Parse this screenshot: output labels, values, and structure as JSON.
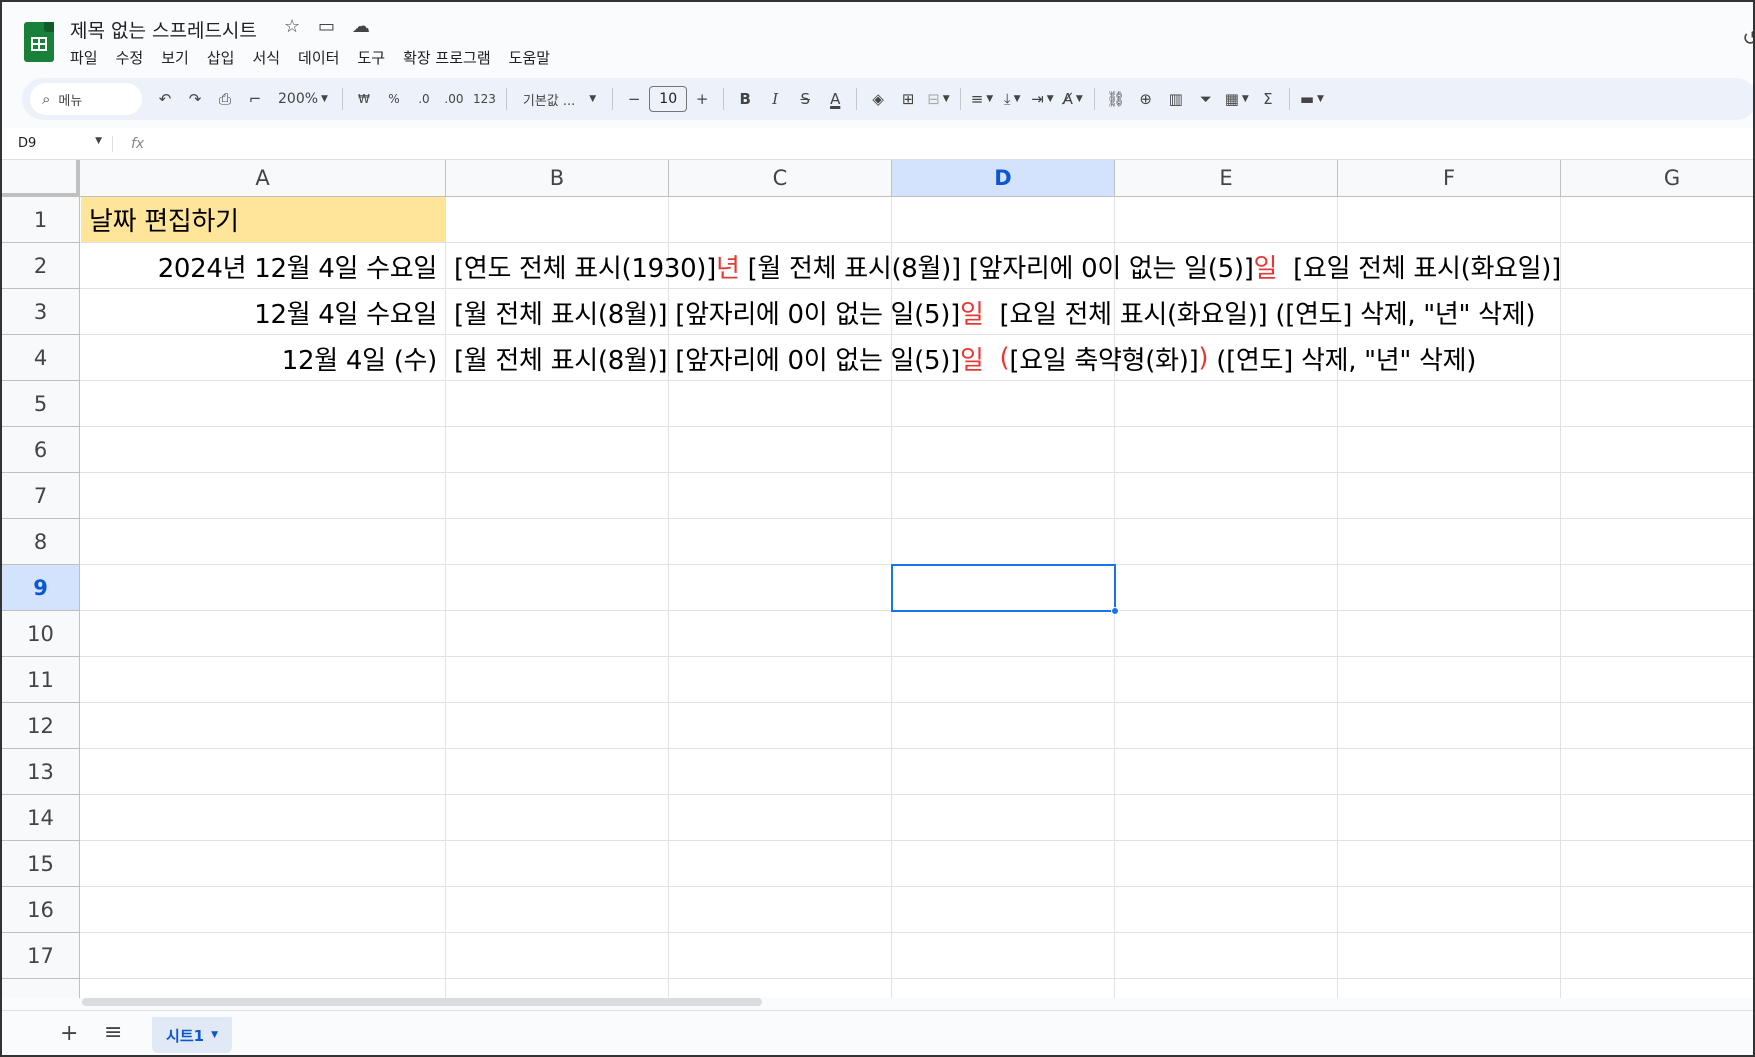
{
  "app": {
    "doc_title": "제목 없는 스프레드시트",
    "menus": [
      "파일",
      "수정",
      "보기",
      "삽입",
      "서식",
      "데이터",
      "도구",
      "확장 프로그램",
      "도움말"
    ]
  },
  "toolbar": {
    "search_label": "메뉴",
    "zoom": "200%",
    "currency": "₩",
    "percent": "%",
    "dec_decrease": ".0",
    "dec_increase": ".00",
    "number_format": "123",
    "font_name": "기본값 ...",
    "font_size": "10",
    "bold": "B",
    "italic": "I",
    "strike": "S",
    "text_color": "A",
    "sum": "Σ"
  },
  "formula_bar": {
    "cell_ref": "D9",
    "fx": "fx",
    "value": ""
  },
  "columns": [
    "A",
    "B",
    "C",
    "D",
    "E",
    "F",
    "G"
  ],
  "rows": [
    "1",
    "2",
    "3",
    "4",
    "5",
    "6",
    "7",
    "8",
    "9",
    "10",
    "11",
    "12",
    "13",
    "14",
    "15",
    "16",
    "17"
  ],
  "cells": {
    "a1": "날짜 편집하기",
    "a2": "2024년 12월 4일 수요일",
    "a3": "12월 4일 수요일",
    "a4": "12월 4일 (수)",
    "b2": {
      "p1": "[연도 전체 표시(1930)]",
      "p2": "년",
      "p3": " [월 전체 표시(8월)] [앞자리에 0이 없는 일(5)]",
      "p4": "일",
      "p5": "  [요일 전체 표시(화요일)]"
    },
    "b3": {
      "p1": "[월 전체 표시(8월)] [앞자리에 0이 없는 일(5)]",
      "p2": "일",
      "p3": "  [요일 전체 표시(화요일)] ([연도] 삭제, \"년\" 삭제)"
    },
    "b4": {
      "p1": "[월 전체 표시(8월)] [앞자리에 0이 없는 일(5)]",
      "p2": "일",
      "p3": "  (",
      "p4": "[요일 축약형(화)]",
      "p5": ")",
      "p6": " ([연도] 삭제, \"년\" 삭제)"
    }
  },
  "selected": {
    "column": "D",
    "row": "9"
  },
  "sheet_tab": "시트1",
  "colors": {
    "header_fill": "#ffe599",
    "accent_red": "#e53935",
    "selection": "#1a73e8"
  }
}
